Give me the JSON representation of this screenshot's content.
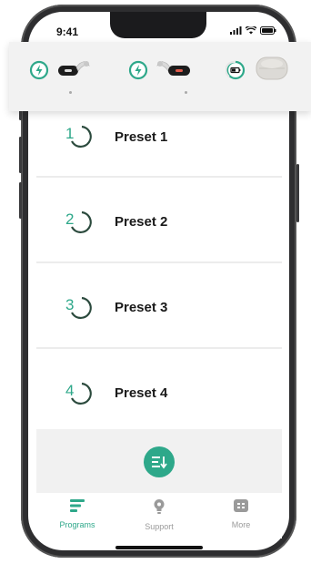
{
  "status_bar": {
    "time": "9:41"
  },
  "colors": {
    "accent": "#2ea88a",
    "icon_dark": "#2b4a3d",
    "tab_inactive": "#9a9a9a"
  },
  "devices": [
    {
      "name": "",
      "icon": "hearing-aid-left-icon",
      "status_icon": "charging-icon"
    },
    {
      "name": "",
      "icon": "hearing-aid-right-icon",
      "status_icon": "charging-icon"
    },
    {
      "name": "",
      "icon": "charger-case-icon",
      "status_icon": "battery-icon"
    }
  ],
  "presets": [
    {
      "number": "1",
      "label": "Preset 1"
    },
    {
      "number": "2",
      "label": "Preset 2"
    },
    {
      "number": "3",
      "label": "Preset 3"
    },
    {
      "number": "4",
      "label": "Preset 4"
    }
  ],
  "action": {
    "icon": "reorder-list-icon"
  },
  "tabs": [
    {
      "label": "Programs",
      "icon": "programs-icon",
      "active": true
    },
    {
      "label": "Support",
      "icon": "lightbulb-icon",
      "active": false
    },
    {
      "label": "More",
      "icon": "more-icon",
      "active": false
    }
  ]
}
